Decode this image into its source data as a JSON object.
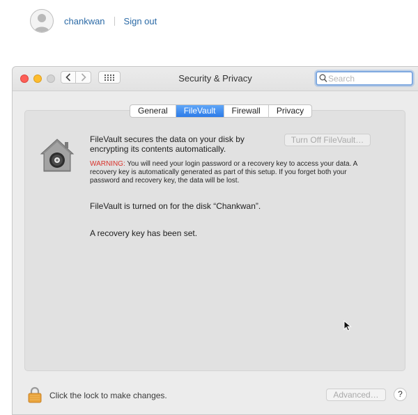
{
  "user": {
    "name": "chankwan",
    "sign_out": "Sign out"
  },
  "window": {
    "title": "Security & Privacy",
    "search_placeholder": "Search",
    "search_value": ""
  },
  "tabs": [
    {
      "label": "General",
      "active": false
    },
    {
      "label": "FileVault",
      "active": true
    },
    {
      "label": "Firewall",
      "active": false
    },
    {
      "label": "Privacy",
      "active": false
    }
  ],
  "filevault": {
    "description": "FileVault secures the data on your disk by encrypting its contents automatically.",
    "turn_off_button": "Turn Off FileVault…",
    "warning_label": "WARNING:",
    "warning_text": " You will need your login password or a recovery key to access your data. A recovery key is automatically generated as part of this setup. If you forget both your password and recovery key, the data will be lost.",
    "status_disk": "FileVault is turned on for the disk “Chankwan”.",
    "status_recovery": "A recovery key has been set."
  },
  "footer": {
    "lock_text": "Click the lock to make changes.",
    "advanced_button": "Advanced…",
    "help_label": "?"
  },
  "colors": {
    "accent": "#2c7be8",
    "link": "#2b6aa6",
    "warning": "#d8322b",
    "close": "#fd5f57",
    "minimize": "#fdbc2e"
  },
  "icons": {
    "avatar": "person-silhouette-icon",
    "back": "chevron-left-icon",
    "forward": "chevron-right-icon",
    "grid": "grid-icon",
    "search": "magnifier-icon",
    "filevault": "house-lock-icon",
    "padlock": "padlock-icon",
    "cursor": "arrow-cursor-icon"
  }
}
